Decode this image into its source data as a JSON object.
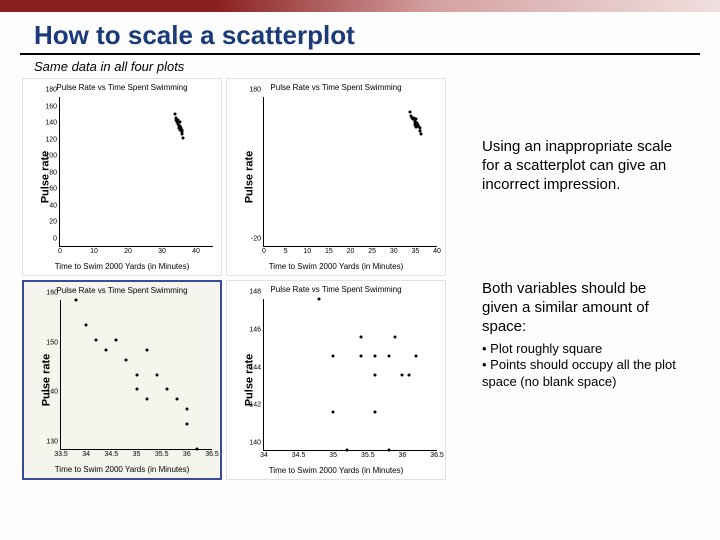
{
  "title": "How to scale a scatterplot",
  "subtitle": "Same data in all four plots",
  "side": {
    "para1": "Using an inappropriate scale for a scatterplot can give an incorrect impression.",
    "para2": "Both variables should be given a similar amount of space:",
    "bullet1": "• Plot roughly square",
    "bullet2": "• Points should occupy all the plot space (no blank space)"
  },
  "chart_data": [
    {
      "type": "scatter",
      "title": "Pulse Rate vs Time Spent Swimming",
      "xlabel": "Time to Swim 2000 Yards (in Minutes)",
      "ylabel": "Pulse rate",
      "xlim": [
        0,
        45
      ],
      "ylim": [
        0,
        180
      ],
      "xticks": [
        0,
        10,
        20,
        30,
        40
      ],
      "yticks": [
        0,
        20,
        40,
        60,
        80,
        100,
        120,
        140,
        160,
        180
      ],
      "points": [
        {
          "x": 33.8,
          "y": 160
        },
        {
          "x": 34.0,
          "y": 155
        },
        {
          "x": 34.2,
          "y": 152
        },
        {
          "x": 34.4,
          "y": 150
        },
        {
          "x": 34.6,
          "y": 152
        },
        {
          "x": 34.8,
          "y": 148
        },
        {
          "x": 35.0,
          "y": 145
        },
        {
          "x": 35.2,
          "y": 150
        },
        {
          "x": 35.0,
          "y": 142
        },
        {
          "x": 35.2,
          "y": 140
        },
        {
          "x": 35.4,
          "y": 145
        },
        {
          "x": 35.6,
          "y": 142
        },
        {
          "x": 35.8,
          "y": 140
        },
        {
          "x": 36.0,
          "y": 138
        },
        {
          "x": 36.0,
          "y": 135
        },
        {
          "x": 36.2,
          "y": 130
        }
      ]
    },
    {
      "type": "scatter",
      "title": "Pulse Rate vs Time Spent Swimming",
      "xlabel": "Time to Swim 2000 Yards (in Minutes)",
      "ylabel": "Pulse rate",
      "xlim": [
        0,
        40
      ],
      "ylim": [
        -20,
        180
      ],
      "xticks": [
        0,
        5,
        10,
        15,
        20,
        25,
        30,
        35,
        40
      ],
      "yticks": [
        -20,
        180
      ],
      "points": [
        {
          "x": 33.8,
          "y": 160
        },
        {
          "x": 34.0,
          "y": 155
        },
        {
          "x": 34.2,
          "y": 152
        },
        {
          "x": 34.4,
          "y": 150
        },
        {
          "x": 34.6,
          "y": 152
        },
        {
          "x": 34.8,
          "y": 148
        },
        {
          "x": 35.0,
          "y": 145
        },
        {
          "x": 35.2,
          "y": 150
        },
        {
          "x": 35.0,
          "y": 142
        },
        {
          "x": 35.2,
          "y": 140
        },
        {
          "x": 35.4,
          "y": 145
        },
        {
          "x": 35.6,
          "y": 142
        },
        {
          "x": 35.8,
          "y": 140
        },
        {
          "x": 36.0,
          "y": 138
        },
        {
          "x": 36.0,
          "y": 135
        },
        {
          "x": 36.2,
          "y": 130
        }
      ]
    },
    {
      "type": "scatter",
      "title": "Pulse Rate vs Time Spent Swimming",
      "xlabel": "Time to Swim 2000 Yards (in Minutes)",
      "ylabel": "Pulse rate",
      "xlim": [
        33.5,
        36.5
      ],
      "ylim": [
        130,
        160
      ],
      "xticks": [
        33.5,
        34,
        34.5,
        35,
        35.5,
        36,
        36.5
      ],
      "yticks": [
        130,
        140,
        150,
        160
      ],
      "points": [
        {
          "x": 33.8,
          "y": 160
        },
        {
          "x": 34.0,
          "y": 155
        },
        {
          "x": 34.2,
          "y": 152
        },
        {
          "x": 34.4,
          "y": 150
        },
        {
          "x": 34.6,
          "y": 152
        },
        {
          "x": 34.8,
          "y": 148
        },
        {
          "x": 35.0,
          "y": 145
        },
        {
          "x": 35.2,
          "y": 150
        },
        {
          "x": 35.0,
          "y": 142
        },
        {
          "x": 35.2,
          "y": 140
        },
        {
          "x": 35.4,
          "y": 145
        },
        {
          "x": 35.6,
          "y": 142
        },
        {
          "x": 35.8,
          "y": 140
        },
        {
          "x": 36.0,
          "y": 138
        },
        {
          "x": 36.0,
          "y": 135
        },
        {
          "x": 36.2,
          "y": 130
        }
      ]
    },
    {
      "type": "scatter",
      "title": "Pulse Rate vs Time Spent Swimming",
      "xlabel": "Time to Swim 2000 Yards (in Minutes)",
      "ylabel": "Pulse rate",
      "xlim": [
        34,
        36.5
      ],
      "ylim": [
        140,
        148
      ],
      "xticks": [
        34,
        34.5,
        35,
        35.5,
        36,
        36.5
      ],
      "yticks": [
        140,
        142,
        144,
        146,
        148
      ],
      "points": [
        {
          "x": 34.8,
          "y": 148
        },
        {
          "x": 35.0,
          "y": 145
        },
        {
          "x": 35.4,
          "y": 145
        },
        {
          "x": 35.4,
          "y": 146
        },
        {
          "x": 35.6,
          "y": 145
        },
        {
          "x": 35.6,
          "y": 144
        },
        {
          "x": 35.8,
          "y": 145
        },
        {
          "x": 35.0,
          "y": 142
        },
        {
          "x": 35.2,
          "y": 140
        },
        {
          "x": 35.6,
          "y": 142
        },
        {
          "x": 35.8,
          "y": 140
        },
        {
          "x": 36.0,
          "y": 144
        },
        {
          "x": 36.1,
          "y": 144
        },
        {
          "x": 36.2,
          "y": 145
        },
        {
          "x": 35.9,
          "y": 146
        }
      ]
    }
  ]
}
